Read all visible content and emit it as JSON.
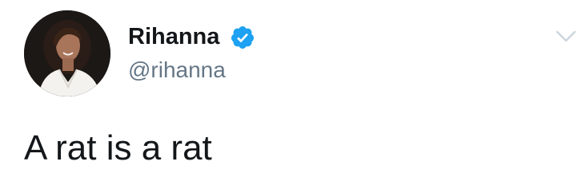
{
  "tweet": {
    "author": {
      "display_name": "Rihanna",
      "handle": "@rihanna",
      "verified": true,
      "avatar_icon": "profile-photo"
    },
    "text": "A rat is a rat",
    "menu_icon": "chevron-down-icon"
  },
  "colors": {
    "text_primary": "#14171a",
    "text_secondary": "#657786",
    "verified_blue": "#1da1f2",
    "caret_gray": "#ccd6dd"
  }
}
